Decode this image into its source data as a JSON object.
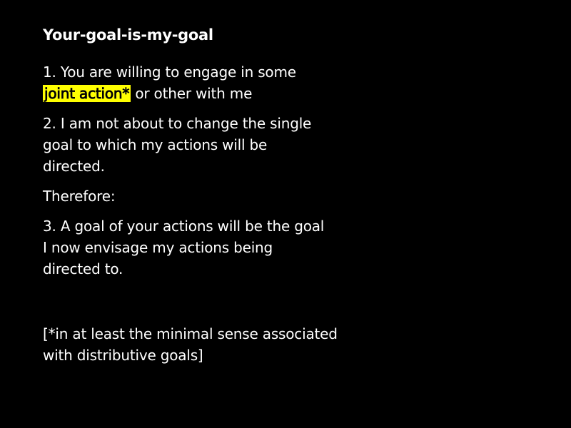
{
  "slide": {
    "title": "Your-goal-is-my-goal",
    "premise1": {
      "prefix": "1. You are willing to engage in some ",
      "highlight": "joint action*",
      "suffix": " or other with me"
    },
    "premise2": "2. I am not about to change the single goal to which my actions will be directed.",
    "therefore": "Therefore:",
    "conclusion": "3. A goal of your actions will be the goal I now envisage my actions being directed to.",
    "footnote": "[*in at least the minimal sense associated with distributive goals]",
    "colors": {
      "background": "#000000",
      "text": "#ffffff",
      "highlight": "#ffff00"
    }
  }
}
